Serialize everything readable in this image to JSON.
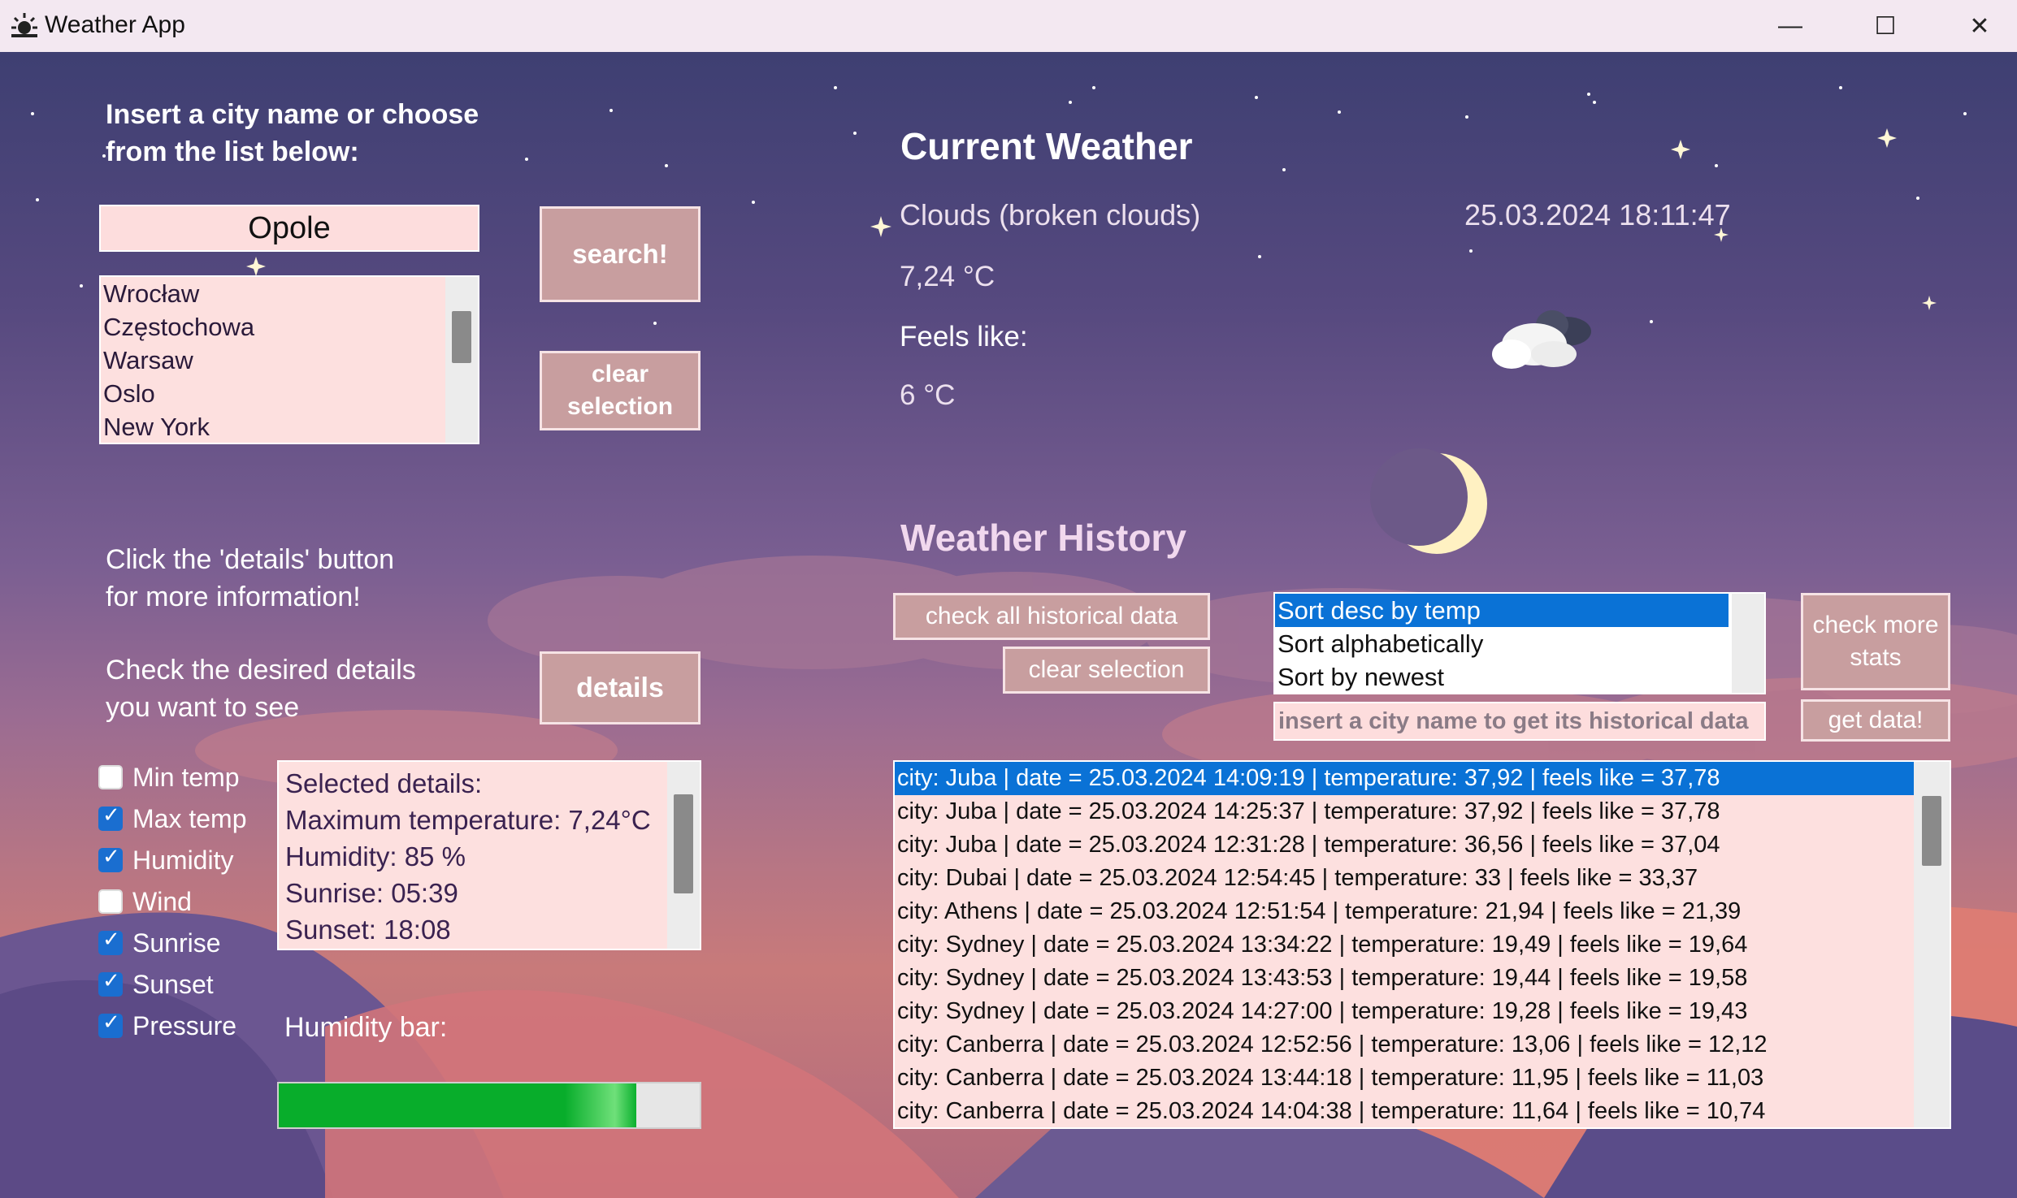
{
  "window": {
    "title": "Weather App",
    "minimize": "—",
    "maximize": "☐",
    "close": "✕"
  },
  "search": {
    "prompt_line1": "Insert a city name or choose",
    "prompt_line2": "from the list below:",
    "city_input": "Opole",
    "search_button": "search!",
    "clear_selection_line1": "clear",
    "clear_selection_line2": "selection",
    "cities": [
      "Wrocław",
      "Częstochowa",
      "Warsaw",
      "Oslo",
      "New York"
    ]
  },
  "details": {
    "info_line1": "Click the 'details' button",
    "info_line2": "for more information!",
    "check_line1": "Check the desired details",
    "check_line2": "you want to see",
    "details_button": "details",
    "options": [
      {
        "label": "Min temp",
        "checked": false
      },
      {
        "label": "Max temp",
        "checked": true
      },
      {
        "label": "Humidity",
        "checked": true
      },
      {
        "label": "Wind",
        "checked": false
      },
      {
        "label": "Sunrise",
        "checked": true
      },
      {
        "label": "Sunset",
        "checked": true
      },
      {
        "label": "Pressure",
        "checked": true
      }
    ],
    "selected_lines": [
      "Selected details:",
      "Maximum temperature: 7,24°C",
      "Humidity: 85 %",
      "Sunrise: 05:39",
      "Sunset: 18:08"
    ],
    "humidity_label": "Humidity bar:",
    "humidity_value": 0.85,
    "humidity_bar_color": "#0bb02e"
  },
  "current": {
    "heading": "Current Weather",
    "description": "Clouds (broken clouds)",
    "datetime": "25.03.2024 18:11:47",
    "temperature": "7,24 °C",
    "feels_like_label": "Feels like:",
    "feels_like_value": "6 °C",
    "weather_icon": "cloud-moon-icon"
  },
  "history": {
    "heading": "Weather History",
    "check_all_button": "check all historical data",
    "clear_selection_button": "clear selection",
    "sort_options": [
      "Sort desc by temp",
      "Sort alphabetically",
      "Sort by newest"
    ],
    "sort_selected_index": 0,
    "check_more_line1": "check more",
    "check_more_line2": "stats",
    "city_input_placeholder": "insert a city name to get its historical data",
    "get_data_button": "get data!",
    "records": [
      "city: Juba | date = 25.03.2024 14:09:19 | temperature: 37,92 | feels like = 37,78",
      "city: Juba | date = 25.03.2024 14:25:37 | temperature: 37,92 | feels like = 37,78",
      "city: Juba | date = 25.03.2024 12:31:28 | temperature: 36,56 | feels like = 37,04",
      "city: Dubai | date = 25.03.2024 12:54:45 | temperature: 33 | feels like = 33,37",
      "city: Athens | date = 25.03.2024 12:51:54 | temperature: 21,94 | feels like = 21,39",
      "city: Sydney | date = 25.03.2024 13:34:22 | temperature: 19,49 | feels like = 19,64",
      "city: Sydney | date = 25.03.2024 13:43:53 | temperature: 19,44 | feels like = 19,58",
      "city: Sydney | date = 25.03.2024 14:27:00 | temperature: 19,28 | feels like = 19,43",
      "city: Canberra | date = 25.03.2024 12:52:56 | temperature: 13,06 | feels like = 12,12",
      "city: Canberra | date = 25.03.2024 13:44:18 | temperature: 11,95 | feels like = 11,03",
      "city: Canberra | date = 25.03.2024 14:04:38 | temperature: 11,64 | feels like = 10,74"
    ],
    "selected_record_index": 0
  },
  "colors": {
    "selection_blue": "#0a72d6",
    "button_bg": "#c89e9f",
    "field_bg": "#fddddd"
  }
}
